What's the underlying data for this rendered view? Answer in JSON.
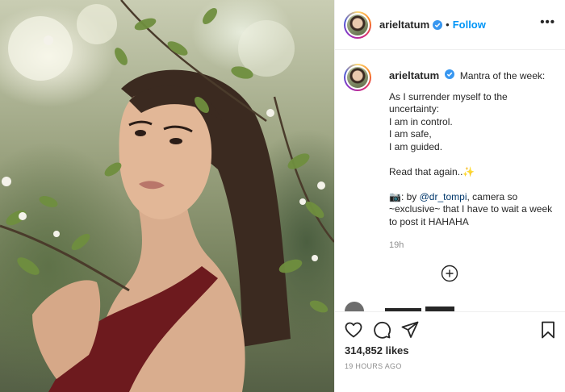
{
  "post": {
    "username": "arieltatum",
    "header_separator": "•",
    "follow_label": "Follow",
    "more_label": "•••",
    "caption": {
      "title": "Mantra of the week:",
      "lines": [
        "As I surrender myself to the",
        "uncertainty:",
        "I am in control.",
        "I am safe,",
        "I am guided.",
        "",
        "Read that again..✨",
        "",
        "📷: by ",
        "~exclusive~ that I have to wait a week",
        "to post it HAHAHA"
      ],
      "credit_prefix": "📷: by ",
      "credit_mention": "@dr_tompi",
      "credit_suffix": ", camera so",
      "time_ago": "19h"
    },
    "likes": "314,852 likes",
    "posted": "19 HOURS AGO"
  },
  "icons": {
    "verified": "verified-badge-icon",
    "more": "more-options-icon",
    "load_more": "plus-circle-icon",
    "like": "heart-icon",
    "comment": "comment-icon",
    "share": "paper-plane-icon",
    "save": "bookmark-icon"
  },
  "colors": {
    "link_blue": "#0095f6",
    "mention": "#00376b",
    "muted": "#8e8e8e",
    "text": "#262626"
  }
}
